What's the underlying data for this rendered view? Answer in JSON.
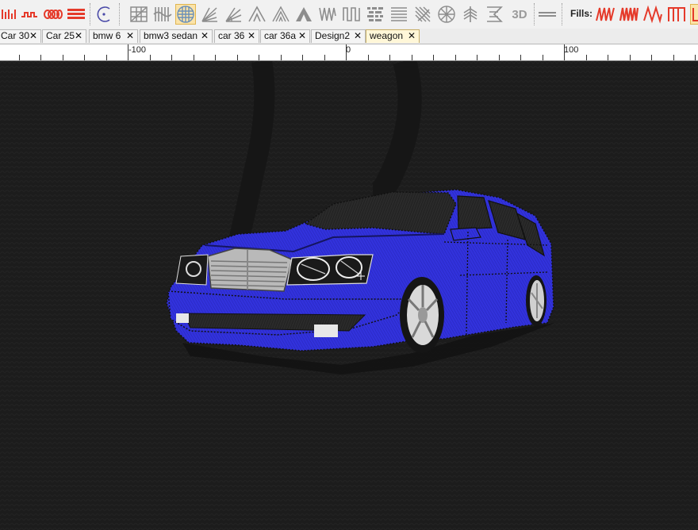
{
  "toolbar": {
    "fills_label": "Fills:",
    "three_d_label": "3D",
    "tools": [
      {
        "icon": "satin-stitch-icon"
      },
      {
        "icon": "zigzag-stitch-icon"
      },
      {
        "icon": "loop-stitch-icon"
      },
      {
        "icon": "layer-stitch-icon"
      },
      {
        "icon": "curve-tool-icon"
      },
      {
        "icon": "grid-fill-icon"
      },
      {
        "icon": "wave-fill-icon"
      },
      {
        "icon": "circle-grid-fill-icon"
      },
      {
        "icon": "fan-fill-icon"
      },
      {
        "icon": "radial-fill-icon"
      },
      {
        "icon": "spike-fill-icon"
      },
      {
        "icon": "mountain-fill-icon"
      },
      {
        "icon": "triangle-fill-icon"
      },
      {
        "icon": "ribbon-fill-icon"
      },
      {
        "icon": "step-fill-icon"
      },
      {
        "icon": "texture-fill-icon"
      },
      {
        "icon": "lines-fill-icon"
      },
      {
        "icon": "burst-fill-icon"
      },
      {
        "icon": "wheel-fill-icon"
      },
      {
        "icon": "feather-fill-icon"
      },
      {
        "icon": "cross-fill-icon"
      },
      {
        "icon": "3d-fill-icon"
      },
      {
        "icon": "double-line-icon"
      }
    ],
    "fill_swatches": [
      {
        "icon": "zigzag-fill-red-icon",
        "color": "#e53a2a"
      },
      {
        "icon": "dense-zigzag-fill-red-icon",
        "color": "#e53a2a"
      },
      {
        "icon": "open-zigzag-fill-red-icon",
        "color": "#e53a2a"
      },
      {
        "icon": "column-fill-red-icon",
        "color": "#e53a2a"
      }
    ]
  },
  "tabs": [
    {
      "label": "Car 30",
      "active": false
    },
    {
      "label": "Car 25",
      "active": false
    },
    {
      "label": "bmw 6",
      "active": false
    },
    {
      "label": "bmw3 sedan",
      "active": false
    },
    {
      "label": "car 36",
      "active": false
    },
    {
      "label": "car 36a",
      "active": false
    },
    {
      "label": "Design2",
      "active": false
    },
    {
      "label": "weagon",
      "active": true
    }
  ],
  "tab_close_glyph": "✕",
  "ruler": {
    "labels": [
      "-100",
      "0",
      "100"
    ]
  },
  "canvas": {
    "background": "#1c1c1c",
    "car_color": "#3030d8",
    "accent_red": "#e53a2a"
  }
}
